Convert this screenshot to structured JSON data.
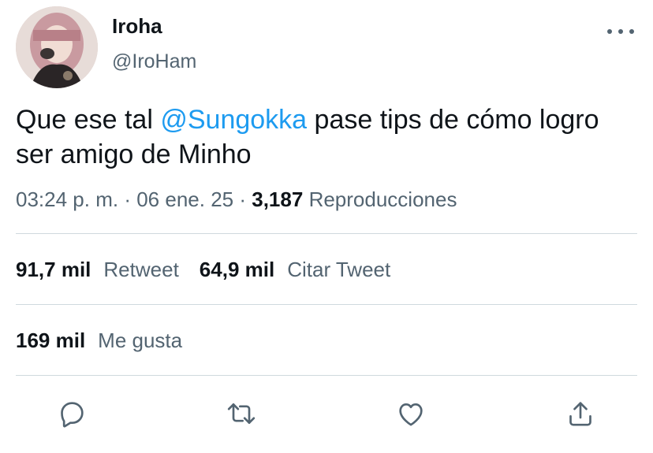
{
  "author": {
    "display_name": "Iroha",
    "handle": "@IroHam"
  },
  "tweet": {
    "text_before": "Que ese tal ",
    "mention": "@Sungokka",
    "text_after": " pase tips de cómo logro ser amigo de Minho"
  },
  "meta": {
    "time": "03:24 p. m.",
    "separator": "·",
    "date": "06 ene. 25",
    "views_count": "3,187",
    "views_label": "Reproducciones"
  },
  "stats": {
    "retweets_count": "91,7 mil",
    "retweets_label": "Retweet",
    "quotes_count": "64,9 mil",
    "quotes_label": "Citar Tweet",
    "likes_count": "169 mil",
    "likes_label": "Me gusta"
  },
  "actions": {
    "reply_icon": "reply-icon",
    "retweet_icon": "retweet-icon",
    "like_icon": "heart-icon",
    "share_icon": "share-icon"
  },
  "colors": {
    "accent": "#1d9bf0",
    "text": "#0f1419",
    "secondary": "#536471",
    "divider": "#cfd9de"
  }
}
